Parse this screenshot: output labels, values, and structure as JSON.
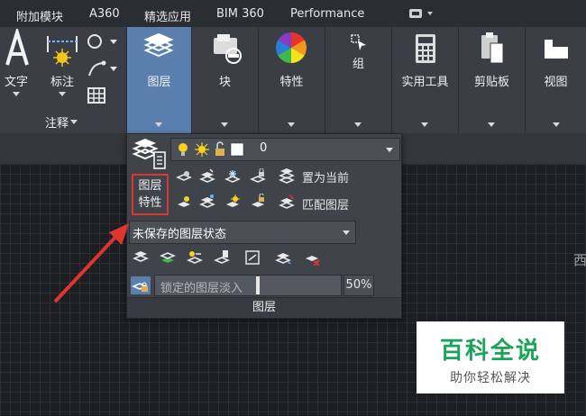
{
  "tabs": [
    "附加模块",
    "A360",
    "精选应用",
    "BIM 360",
    "Performance"
  ],
  "ribbon": {
    "annotation": {
      "text_label": "文字",
      "dimension_label": "标注",
      "panel_title": "注释"
    },
    "layers_button": "图层",
    "block_button": "块",
    "properties_button": "特性",
    "group_button": "组",
    "utilities_button": "实用工具",
    "clipboard_button": "剪贴板",
    "view_button": "视图"
  },
  "layer_panel": {
    "current_layer": "0",
    "layer_properties_label_line1": "图层",
    "layer_properties_label_line2": "特性",
    "set_current_label": "置为当前",
    "match_layer_label": "匹配图层",
    "layer_state": "未保存的图层状态",
    "locked_fade_label": "锁定的图层淡入",
    "locked_fade_value": "50%",
    "caption": "图层"
  },
  "drawing": {
    "viewcube_partial": "西"
  },
  "watermark": {
    "title": "百科全说",
    "subtitle": "助你轻松解决"
  },
  "colors": {
    "highlight_box": "#e0342f",
    "arrow": "#e0342f",
    "active_button": "#5a7fae"
  }
}
